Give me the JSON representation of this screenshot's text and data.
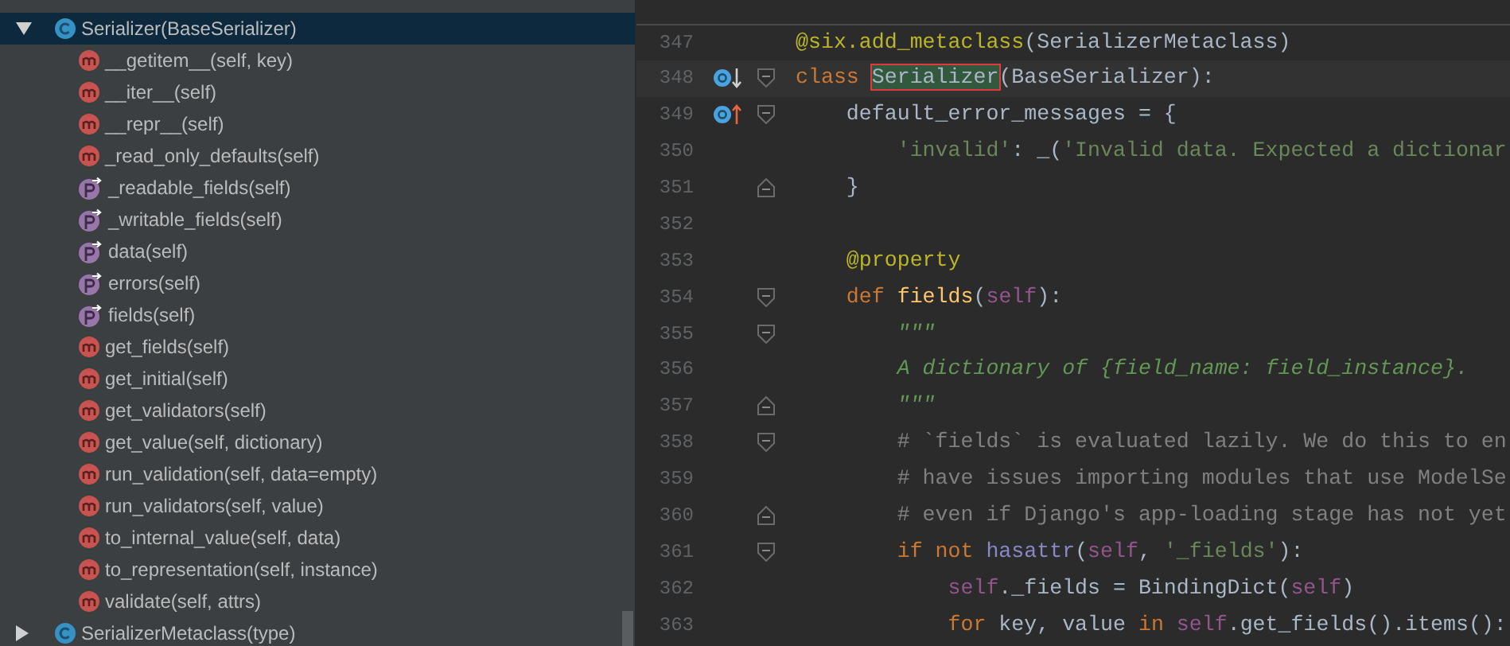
{
  "structure": {
    "items": [
      {
        "kind": "class",
        "label": "Serializer(BaseSerializer)",
        "selected": true,
        "expanded": true,
        "children": [
          {
            "kind": "method",
            "label": "__getitem__(self, key)",
            "selected": false
          },
          {
            "kind": "method",
            "label": "__iter__(self)",
            "selected": false
          },
          {
            "kind": "method",
            "label": "__repr__(self)",
            "selected": false
          },
          {
            "kind": "method",
            "label": "_read_only_defaults(self)",
            "selected": false
          },
          {
            "kind": "property",
            "label": "_readable_fields(self)",
            "selected": false
          },
          {
            "kind": "property",
            "label": "_writable_fields(self)",
            "selected": false
          },
          {
            "kind": "property",
            "label": "data(self)",
            "selected": false
          },
          {
            "kind": "property",
            "label": "errors(self)",
            "selected": false
          },
          {
            "kind": "property",
            "label": "fields(self)",
            "selected": false
          },
          {
            "kind": "method",
            "label": "get_fields(self)",
            "selected": false
          },
          {
            "kind": "method",
            "label": "get_initial(self)",
            "selected": false
          },
          {
            "kind": "method",
            "label": "get_validators(self)",
            "selected": false
          },
          {
            "kind": "method",
            "label": "get_value(self, dictionary)",
            "selected": false
          },
          {
            "kind": "method",
            "label": "run_validation(self, data=empty)",
            "selected": false
          },
          {
            "kind": "method",
            "label": "run_validators(self, value)",
            "selected": false
          },
          {
            "kind": "method",
            "label": "to_internal_value(self, data)",
            "selected": false
          },
          {
            "kind": "method",
            "label": "to_representation(self, instance)",
            "selected": false
          },
          {
            "kind": "method",
            "label": "validate(self, attrs)",
            "selected": false
          }
        ]
      },
      {
        "kind": "class",
        "label": "SerializerMetaclass(type)",
        "selected": false,
        "expanded": false
      }
    ]
  },
  "editor": {
    "lines": [
      {
        "number": "347",
        "fold_start": false,
        "fold_end": false,
        "overridden": false,
        "overrides": false,
        "current": false,
        "tokens": [
          {
            "kind": "decorator",
            "text": "@six.add_metaclass"
          },
          {
            "kind": "plain",
            "text": "(SerializerMetaclass)"
          }
        ]
      },
      {
        "number": "348",
        "fold_start": true,
        "fold_end": false,
        "overridden": true,
        "overrides": false,
        "current": true,
        "tokens": [
          {
            "kind": "keyword",
            "text": "class "
          },
          {
            "kind": "match",
            "text": "Serializer"
          },
          {
            "kind": "plain",
            "text": "(BaseSerializer):"
          }
        ]
      },
      {
        "number": "349",
        "fold_start": true,
        "fold_end": false,
        "overridden": false,
        "overrides": true,
        "current": false,
        "tokens": [
          {
            "kind": "plain",
            "text": "    default_error_messages = {"
          }
        ]
      },
      {
        "number": "350",
        "fold_start": false,
        "fold_end": false,
        "overridden": false,
        "overrides": false,
        "current": false,
        "tokens": [
          {
            "kind": "string",
            "text": "        'invalid'"
          },
          {
            "kind": "plain",
            "text": ": _("
          },
          {
            "kind": "string",
            "text": "'Invalid data. Expected a dictionar"
          }
        ]
      },
      {
        "number": "351",
        "fold_start": false,
        "fold_end": true,
        "overridden": false,
        "overrides": false,
        "current": false,
        "tokens": [
          {
            "kind": "plain",
            "text": "    }"
          }
        ]
      },
      {
        "number": "352",
        "fold_start": false,
        "fold_end": false,
        "overridden": false,
        "overrides": false,
        "current": false
      },
      {
        "number": "353",
        "fold_start": false,
        "fold_end": false,
        "overridden": false,
        "overrides": false,
        "current": false,
        "tokens": [
          {
            "kind": "decorator",
            "text": "    @property"
          }
        ]
      },
      {
        "number": "354",
        "fold_start": true,
        "fold_end": false,
        "overridden": false,
        "overrides": false,
        "current": false,
        "tokens": [
          {
            "kind": "keyword",
            "text": "    def "
          },
          {
            "kind": "function",
            "text": "fields"
          },
          {
            "kind": "plain",
            "text": "("
          },
          {
            "kind": "self",
            "text": "self"
          },
          {
            "kind": "plain",
            "text": "):"
          }
        ]
      },
      {
        "number": "355",
        "fold_start": true,
        "fold_end": false,
        "overridden": false,
        "overrides": false,
        "current": false,
        "tokens": [
          {
            "kind": "docstring",
            "text": "        \"\"\""
          }
        ]
      },
      {
        "number": "356",
        "fold_start": false,
        "fold_end": false,
        "overridden": false,
        "overrides": false,
        "current": false,
        "tokens": [
          {
            "kind": "docstring",
            "text": "        A dictionary of {field_name: field_instance}."
          }
        ]
      },
      {
        "number": "357",
        "fold_start": false,
        "fold_end": true,
        "overridden": false,
        "overrides": false,
        "current": false,
        "tokens": [
          {
            "kind": "docstring",
            "text": "        \"\"\""
          }
        ]
      },
      {
        "number": "358",
        "fold_start": true,
        "fold_end": false,
        "overridden": false,
        "overrides": false,
        "current": false,
        "tokens": [
          {
            "kind": "comment",
            "text": "        # `fields` is evaluated lazily. We do this to en"
          }
        ]
      },
      {
        "number": "359",
        "fold_start": false,
        "fold_end": false,
        "overridden": false,
        "overrides": false,
        "current": false,
        "tokens": [
          {
            "kind": "comment",
            "text": "        # have issues importing modules that use ModelSe"
          }
        ]
      },
      {
        "number": "360",
        "fold_start": false,
        "fold_end": true,
        "overridden": false,
        "overrides": false,
        "current": false,
        "tokens": [
          {
            "kind": "comment",
            "text": "        # even if Django's app-loading stage has not yet"
          }
        ]
      },
      {
        "number": "361",
        "fold_start": true,
        "fold_end": false,
        "overridden": false,
        "overrides": false,
        "current": false,
        "tokens": [
          {
            "kind": "keyword",
            "text": "        if not "
          },
          {
            "kind": "builtin",
            "text": "hasattr"
          },
          {
            "kind": "plain",
            "text": "("
          },
          {
            "kind": "self",
            "text": "self"
          },
          {
            "kind": "plain",
            "text": ", "
          },
          {
            "kind": "string",
            "text": "'_fields'"
          },
          {
            "kind": "plain",
            "text": "):"
          }
        ]
      },
      {
        "number": "362",
        "fold_start": false,
        "fold_end": false,
        "overridden": false,
        "overrides": false,
        "current": false,
        "tokens": [
          {
            "kind": "self",
            "text": "            self"
          },
          {
            "kind": "plain",
            "text": "._fields = BindingDict("
          },
          {
            "kind": "self",
            "text": "self"
          },
          {
            "kind": "plain",
            "text": ")"
          }
        ]
      },
      {
        "number": "363",
        "fold_start": false,
        "fold_end": false,
        "overridden": false,
        "overrides": false,
        "current": false,
        "tokens": [
          {
            "kind": "keyword",
            "text": "            for"
          },
          {
            "kind": "plain",
            "text": " key, value "
          },
          {
            "kind": "keyword",
            "text": "in "
          },
          {
            "kind": "self",
            "text": "self"
          },
          {
            "kind": "plain",
            "text": ".get_fields().items():"
          }
        ]
      }
    ]
  }
}
